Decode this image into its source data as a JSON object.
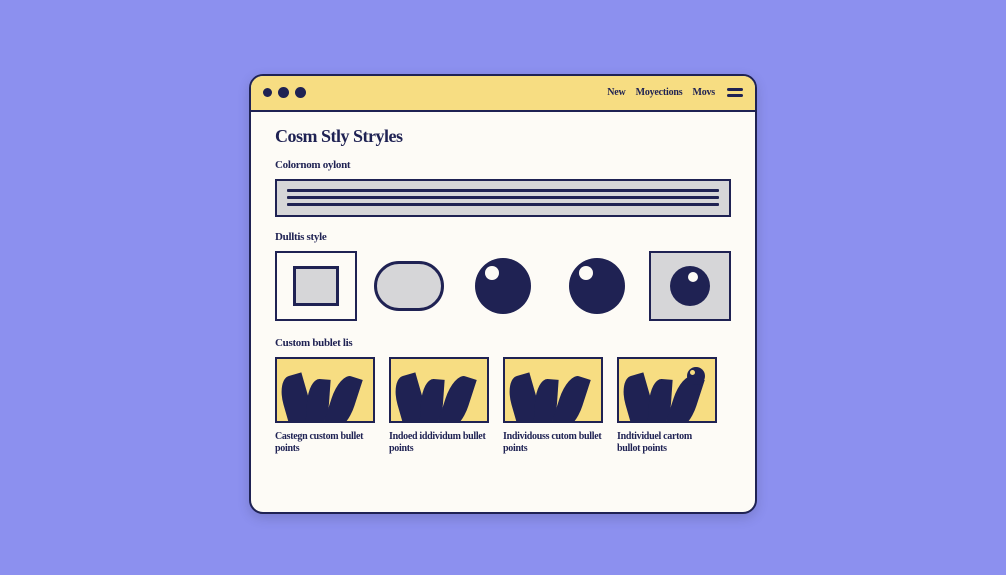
{
  "colors": {
    "background": "#8c90ef",
    "accent": "#f7dd82",
    "ink": "#1f2253",
    "panel": "#fdfbf6",
    "neutral": "#d6d6d8"
  },
  "nav": {
    "items": [
      "New",
      "Moyections",
      "Movs"
    ]
  },
  "page": {
    "title": "Cosm Stly Stryles"
  },
  "sections": {
    "colornom": {
      "label": "Colornom oylont"
    },
    "dullis": {
      "label": "Dulltis style"
    },
    "custom": {
      "label": "Custom bublet lis"
    }
  },
  "shapes": [
    {
      "name": "square"
    },
    {
      "name": "pill"
    },
    {
      "name": "ball-1"
    },
    {
      "name": "ball-2"
    },
    {
      "name": "ball-boxed"
    }
  ],
  "cards": [
    {
      "caption": "Castegn custom bullet points"
    },
    {
      "caption": "Indoed iddividum bullet points"
    },
    {
      "caption": "Individouss cutom bullet points"
    },
    {
      "caption": "Indtividuel cartom bullot points"
    }
  ]
}
